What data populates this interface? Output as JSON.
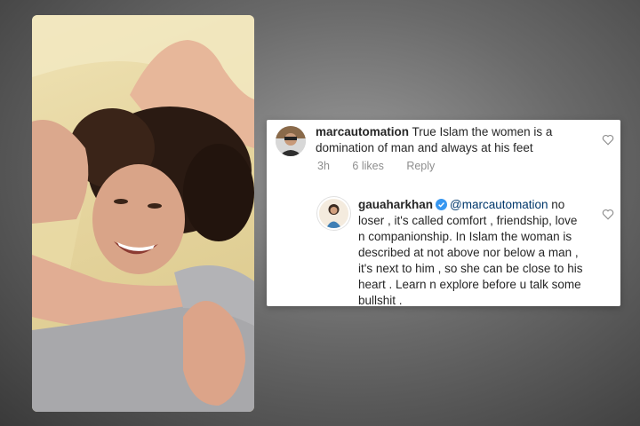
{
  "comment": {
    "username": "marcautomation",
    "text": "True Islam the women is a domination of man and always at his feet",
    "time": "3h",
    "likes": "6 likes",
    "reply_label": "Reply",
    "avatar_icon": "user-avatar-icon",
    "like_icon": "heart-icon"
  },
  "reply": {
    "username": "gauaharkhan",
    "verified_icon": "verified-badge-icon",
    "mention": "@marcautomation",
    "text": "no loser , it's called comfort , friendship, love n companionship. In Islam the woman is described at not above nor below a man , it's next to him , so she can be close to his heart . Learn n explore before u talk some bullshit .",
    "avatar_icon": "user-avatar-icon",
    "like_icon": "heart-icon"
  },
  "colors": {
    "background": "#6a6a6a",
    "card": "#ffffff",
    "text": "#262626",
    "meta": "#8e8e8e",
    "mention": "#00376b",
    "verified": "#3897f0"
  }
}
